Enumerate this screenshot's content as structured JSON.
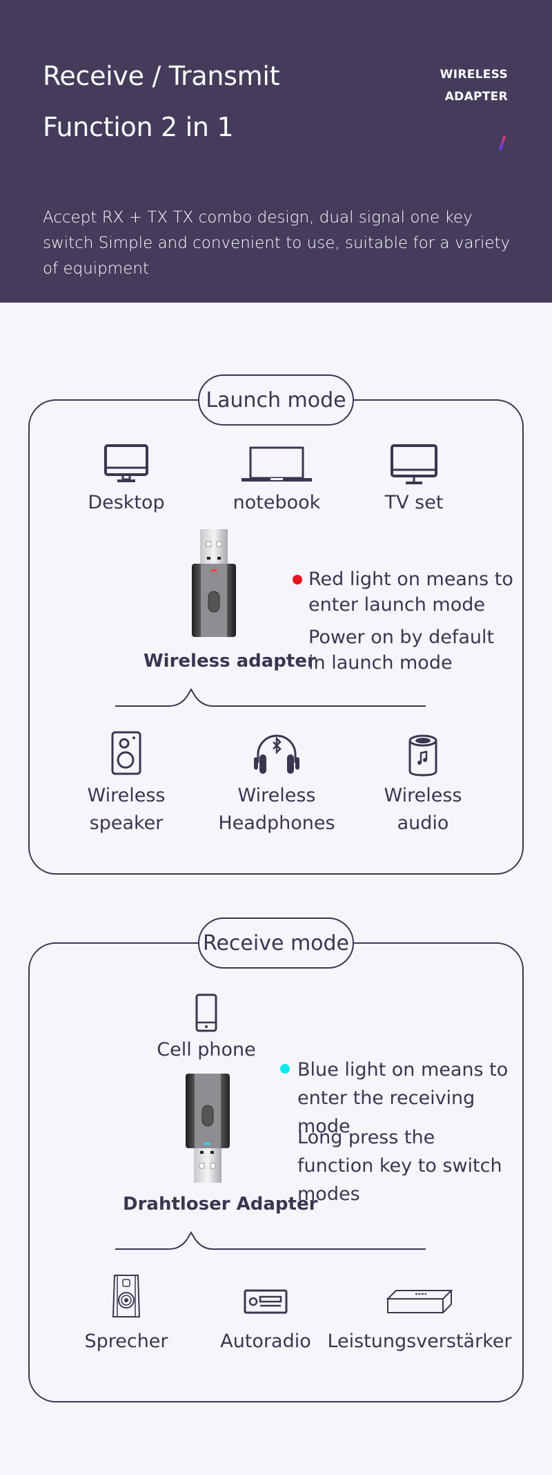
{
  "hero": {
    "title_line1": "Receive / Transmit",
    "title_line2": "Function 2 in 1",
    "brand_line1": "WIRELESS",
    "brand_line2": "ADAPTER",
    "description": "Accept RX + TX TX combo design, dual signal one key switch Simple and convenient to use, suitable for a variety of equipment",
    "background_color": "#453c5c"
  },
  "launch_mode": {
    "title": "Launch mode",
    "sources": [
      {
        "label": "Desktop",
        "icon": "desktop-icon"
      },
      {
        "label": "notebook",
        "icon": "laptop-icon"
      },
      {
        "label": "TV set",
        "icon": "tv-icon"
      }
    ],
    "adapter_label": "Wireless adapter",
    "indicator_color": "#e8141e",
    "notes": [
      "Red light on means to enter launch mode",
      "Power on by default in launch mode"
    ],
    "targets": [
      {
        "label_line1": "Wireless",
        "label_line2": "speaker",
        "icon": "speaker-icon"
      },
      {
        "label_line1": "Wireless",
        "label_line2": "Headphones",
        "icon": "bluetooth-headphones-icon"
      },
      {
        "label_line1": "Wireless",
        "label_line2": "audio",
        "icon": "smart-speaker-icon"
      }
    ]
  },
  "receive_mode": {
    "title": "Receive mode",
    "source": {
      "label": "Cell phone",
      "icon": "phone-icon"
    },
    "adapter_label": "Drahtloser Adapter",
    "indicator_color": "#12e6ee",
    "notes": [
      "Blue light on means to enter the receiving mode",
      "Long press the function key to switch modes"
    ],
    "targets": [
      {
        "label": "Sprecher",
        "icon": "bookshelf-speaker-icon"
      },
      {
        "label": "Autoradio",
        "icon": "car-radio-icon"
      },
      {
        "label": "Leistungsverstärker",
        "icon": "amplifier-icon"
      }
    ]
  }
}
